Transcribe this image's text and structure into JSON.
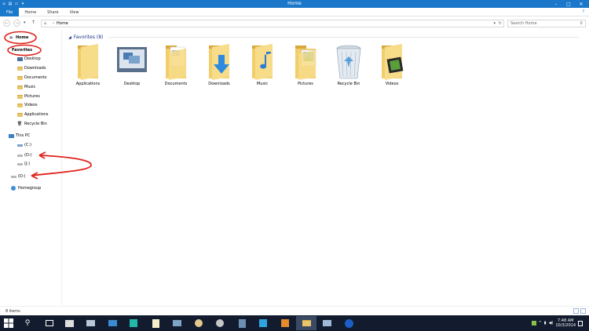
{
  "window": {
    "title": "Home",
    "minimize": "–",
    "maximize": "□",
    "close": "✕"
  },
  "ribbon": {
    "tabs": [
      "File",
      "Home",
      "Share",
      "View"
    ]
  },
  "address": {
    "path": "Home",
    "search_placeholder": "Search Home"
  },
  "nav": {
    "home": "Home",
    "favorites": "Favorites",
    "favorites_items": [
      "Desktop",
      "Downloads",
      "Documents",
      "Music",
      "Pictures",
      "Videos",
      "Applications",
      "Recycle Bin"
    ],
    "this_pc": "This PC",
    "drives": [
      "(C:)",
      "(D:)",
      "(J:)"
    ],
    "root_drive": "(D:)",
    "homegroup": "Homegroup"
  },
  "content": {
    "group_title": "Favorites (8)",
    "items": [
      "Applications",
      "Desktop",
      "Documents",
      "Downloads",
      "Music",
      "Pictures",
      "Recycle Bin",
      "Videos"
    ]
  },
  "status": {
    "count": "8 items"
  },
  "taskbar": {
    "time": "7:48 AM",
    "date": "10/3/2014"
  },
  "colors": {
    "accent": "#1979ca",
    "folder": "#f2cd6b",
    "annotation": "#e0221c",
    "taskbar": "#121c2e"
  }
}
